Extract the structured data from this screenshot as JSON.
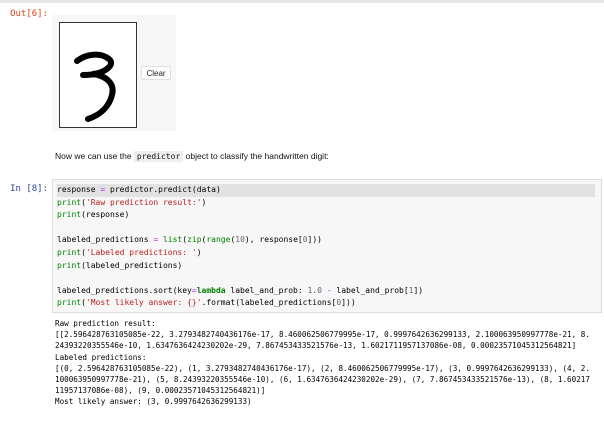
{
  "prompts": {
    "out": "Out[6]:",
    "in": "In [8]:"
  },
  "widget": {
    "clear_label": "Clear"
  },
  "markdown": {
    "prefix": "Now we can use the ",
    "code": "predictor",
    "suffix": " object to classify the handwritten digit:"
  },
  "code": {
    "lines": [
      "response = predictor.predict(data)",
      "print('Raw prediction result:')",
      "print(response)",
      "",
      "labeled_predictions = list(zip(range(10), response[0]))",
      "print('Labeled predictions: ')",
      "print(labeled_predictions)",
      "",
      "labeled_predictions.sort(key=lambda label_and_prob: 1.0 - label_and_prob[1])",
      "print('Most likely answer: {}'.format(labeled_predictions[0]))"
    ]
  },
  "output": {
    "lines": [
      "Raw prediction result:",
      "[[2.596428763105085e-22, 3.2793482740436176e-17, 8.460062506779995e-17, 0.9997642636299133, 2.100063950997778e-21, 8.",
      "24393220355546e-10, 1.6347636424230202e-29, 7.867453433521576e-13, 1.6021711957137086e-08, 0.00023571045312564821]",
      "Labeled predictions:",
      "[(0, 2.596428763105085e-22), (1, 3.2793482740436176e-17), (2, 8.460062506779995e-17), (3, 0.9997642636299133), (4, 2.",
      "100063950997778e-21), (5, 8.24393220355546e-10), (6, 1.6347636424230202e-29), (7, 7.867453433521576e-13), (8, 1.60217",
      "11957137086e-08), (9, 0.00023571045312564821)]",
      "Most likely answer: (3, 0.9997642636299133)"
    ]
  }
}
